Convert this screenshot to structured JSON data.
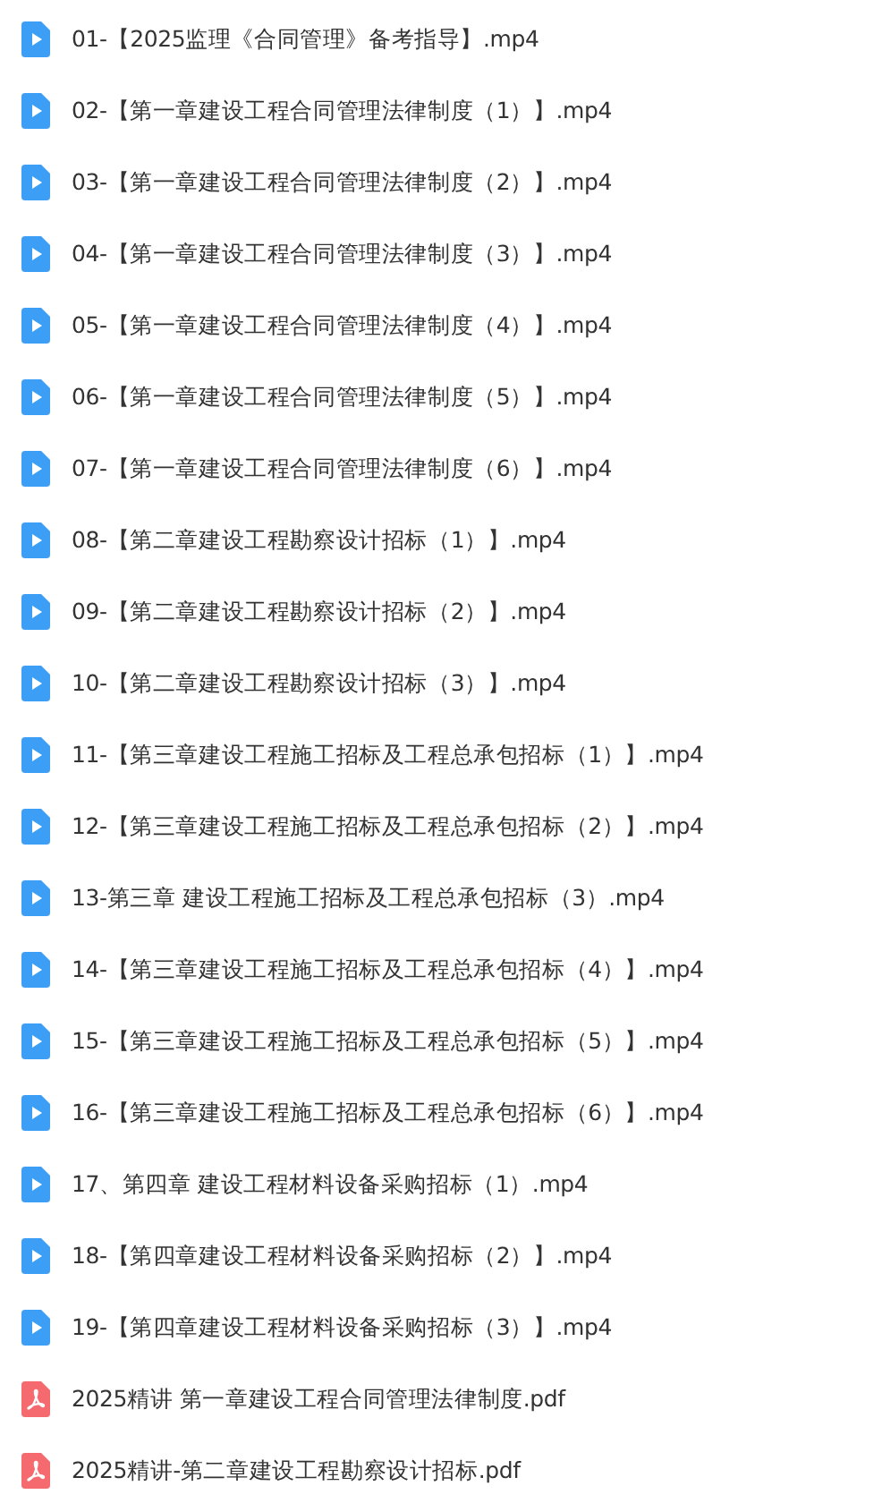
{
  "files": [
    {
      "kind": "video",
      "name": "01-【2025监理《合同管理》备考指导】.mp4"
    },
    {
      "kind": "video",
      "name": "02-【第一章建设工程合同管理法律制度（1）】.mp4"
    },
    {
      "kind": "video",
      "name": "03-【第一章建设工程合同管理法律制度（2）】.mp4"
    },
    {
      "kind": "video",
      "name": "04-【第一章建设工程合同管理法律制度（3）】.mp4"
    },
    {
      "kind": "video",
      "name": "05-【第一章建设工程合同管理法律制度（4）】.mp4"
    },
    {
      "kind": "video",
      "name": "06-【第一章建设工程合同管理法律制度（5）】.mp4"
    },
    {
      "kind": "video",
      "name": "07-【第一章建设工程合同管理法律制度（6）】.mp4"
    },
    {
      "kind": "video",
      "name": "08-【第二章建设工程勘察设计招标（1）】.mp4"
    },
    {
      "kind": "video",
      "name": "09-【第二章建设工程勘察设计招标（2）】.mp4"
    },
    {
      "kind": "video",
      "name": "10-【第二章建设工程勘察设计招标（3）】.mp4"
    },
    {
      "kind": "video",
      "name": "11-【第三章建设工程施工招标及工程总承包招标（1）】.mp4"
    },
    {
      "kind": "video",
      "name": "12-【第三章建设工程施工招标及工程总承包招标（2）】.mp4"
    },
    {
      "kind": "video",
      "name": "13-第三章 建设工程施工招标及工程总承包招标（3）.mp4"
    },
    {
      "kind": "video",
      "name": "14-【第三章建设工程施工招标及工程总承包招标（4）】.mp4"
    },
    {
      "kind": "video",
      "name": "15-【第三章建设工程施工招标及工程总承包招标（5）】.mp4"
    },
    {
      "kind": "video",
      "name": "16-【第三章建设工程施工招标及工程总承包招标（6）】.mp4"
    },
    {
      "kind": "video",
      "name": "17、第四章 建设工程材料设备采购招标（1）.mp4"
    },
    {
      "kind": "video",
      "name": "18-【第四章建设工程材料设备采购招标（2）】.mp4"
    },
    {
      "kind": "video",
      "name": "19-【第四章建设工程材料设备采购招标（3）】.mp4"
    },
    {
      "kind": "pdf",
      "name": "2025精讲 第一章建设工程合同管理法律制度.pdf"
    },
    {
      "kind": "pdf",
      "name": "2025精讲-第二章建设工程勘察设计招标.pdf"
    }
  ]
}
